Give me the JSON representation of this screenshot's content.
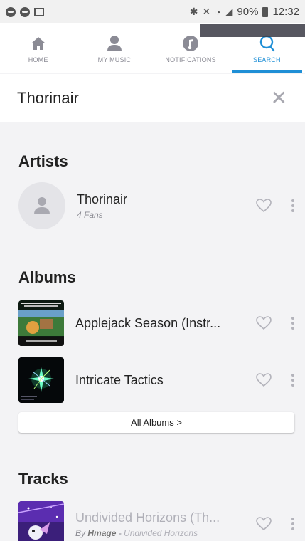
{
  "status_bar": {
    "battery": "90%",
    "time": "12:32"
  },
  "tabs": [
    {
      "label": "HOME",
      "icon": "home-icon",
      "active": false
    },
    {
      "label": "MY MUSIC",
      "icon": "user-icon",
      "active": false
    },
    {
      "label": "NOTIFICATIONS",
      "icon": "music-note-icon",
      "active": false
    },
    {
      "label": "SEARCH",
      "icon": "search-icon",
      "active": true
    }
  ],
  "search": {
    "query": "Thorinair",
    "close_icon": "close-icon"
  },
  "artists": {
    "title": "Artists",
    "items": [
      {
        "name": "Thorinair",
        "subtitle": "4 Fans"
      }
    ]
  },
  "albums": {
    "title": "Albums",
    "items": [
      {
        "name": "Applejack Season (Instr...",
        "art_label": "Thorinair Applejack Season",
        "art_caption": "Instrumental Mix"
      },
      {
        "name": "Intricate Tactics",
        "art_caption": "Intricate Tactics"
      }
    ],
    "all_button": "All Albums >"
  },
  "tracks": {
    "title": "Tracks",
    "items": [
      {
        "name": "Undivided Horizons (Th...",
        "by_prefix": "By",
        "artist": "Hmage",
        "separator": " - ",
        "album": "Undivided Horizons"
      }
    ]
  },
  "colors": {
    "accent": "#1f8fd6",
    "background": "#f3f3f5"
  }
}
